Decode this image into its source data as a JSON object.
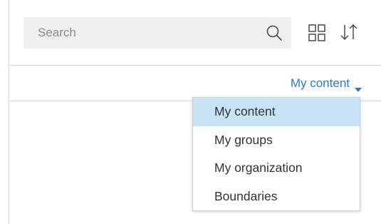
{
  "search": {
    "placeholder": "Search",
    "value": ""
  },
  "toolbar": {
    "grid_icon": "grid-view-icon",
    "sort_icon": "sort-icon",
    "search_icon": "search-icon"
  },
  "filter": {
    "selected_label": "My content",
    "caret_icon": "caret-down-icon",
    "accent_color": "#2c7ac9",
    "selected_bg": "#c7e4f6",
    "options": [
      {
        "label": "My content",
        "selected": true
      },
      {
        "label": "My groups",
        "selected": false
      },
      {
        "label": "My organization",
        "selected": false
      },
      {
        "label": "Boundaries",
        "selected": false
      }
    ]
  }
}
